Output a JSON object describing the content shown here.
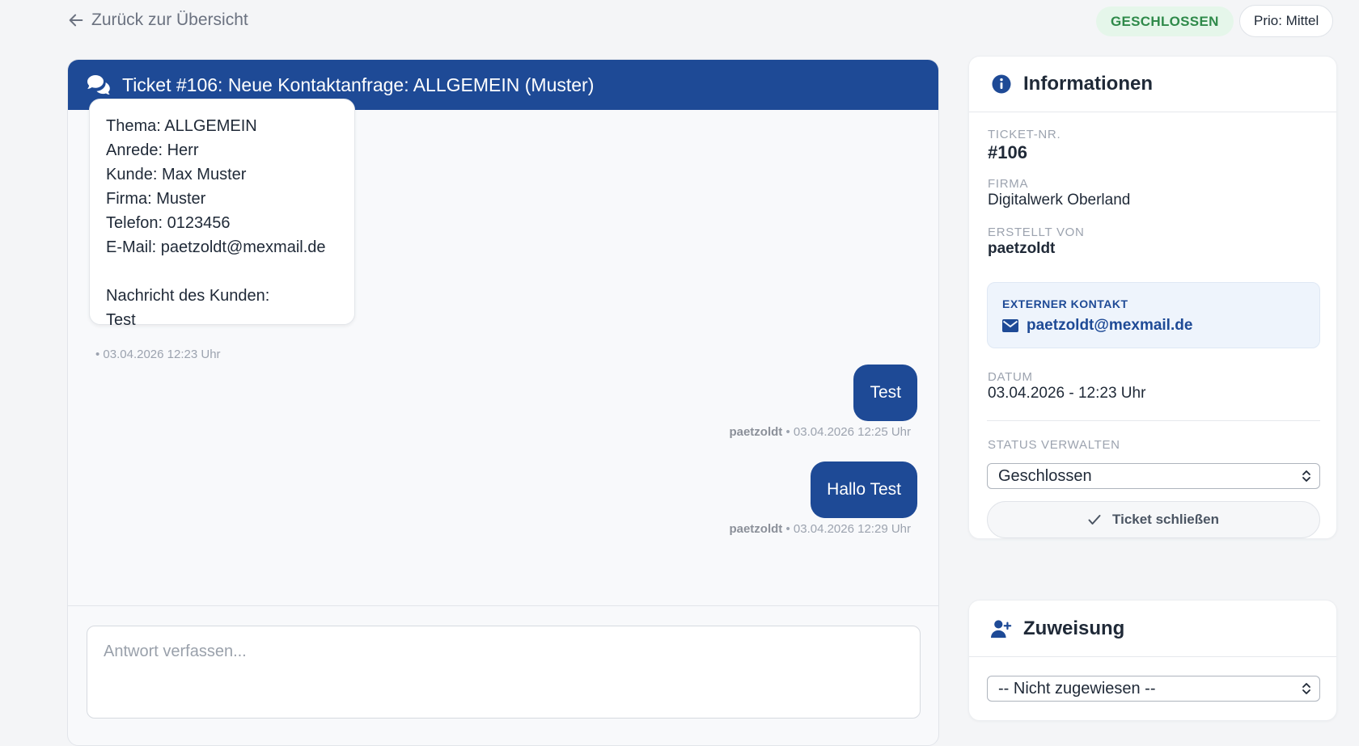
{
  "topbar": {
    "back_label": "Zurück zur Übersicht",
    "status_badge": "GESCHLOSSEN",
    "priority_badge": "Prio: Mittel"
  },
  "chat": {
    "header_title": "Ticket #106: Neue Kontaktanfrage: ALLGEMEIN (Muster)",
    "customer_message": "Thema: ALLGEMEIN\nAnrede: Herr\nKunde: Max Muster\nFirma: Muster\nTelefon: 0123456\nE-Mail: paetzoldt@mexmail.de\n\nNachricht des Kunden:\nTest",
    "customer_meta": "• 03.04.2026 12:23 Uhr",
    "outgoing": [
      {
        "text": "Test",
        "author": "paetzoldt",
        "time": " • 03.04.2026 12:25 Uhr"
      },
      {
        "text": "Hallo Test",
        "author": "paetzoldt",
        "time": " • 03.04.2026 12:29 Uhr"
      }
    ],
    "composer_placeholder": "Antwort verfassen..."
  },
  "info": {
    "title": "Informationen",
    "ticket_nr_label": "TICKET-NR.",
    "ticket_nr": "#106",
    "firma_label": "FIRMA",
    "firma": "Digitalwerk Oberland",
    "created_by_label": "ERSTELLT VON",
    "created_by": "paetzoldt",
    "external_contact_label": "EXTERNER KONTAKT",
    "external_contact_email": "paetzoldt@mexmail.de",
    "date_label": "DATUM",
    "date": "03.04.2026 - 12:23 Uhr",
    "status_label": "STATUS VERWALTEN",
    "status_value": "Geschlossen",
    "close_button": "Ticket schließen"
  },
  "assignment": {
    "title": "Zuweisung",
    "select_value": "-- Nicht zugewiesen --"
  },
  "colors": {
    "primary": "#1e4a96",
    "status_green_text": "#2f8a4a",
    "status_green_bg": "#e5f6ea"
  }
}
